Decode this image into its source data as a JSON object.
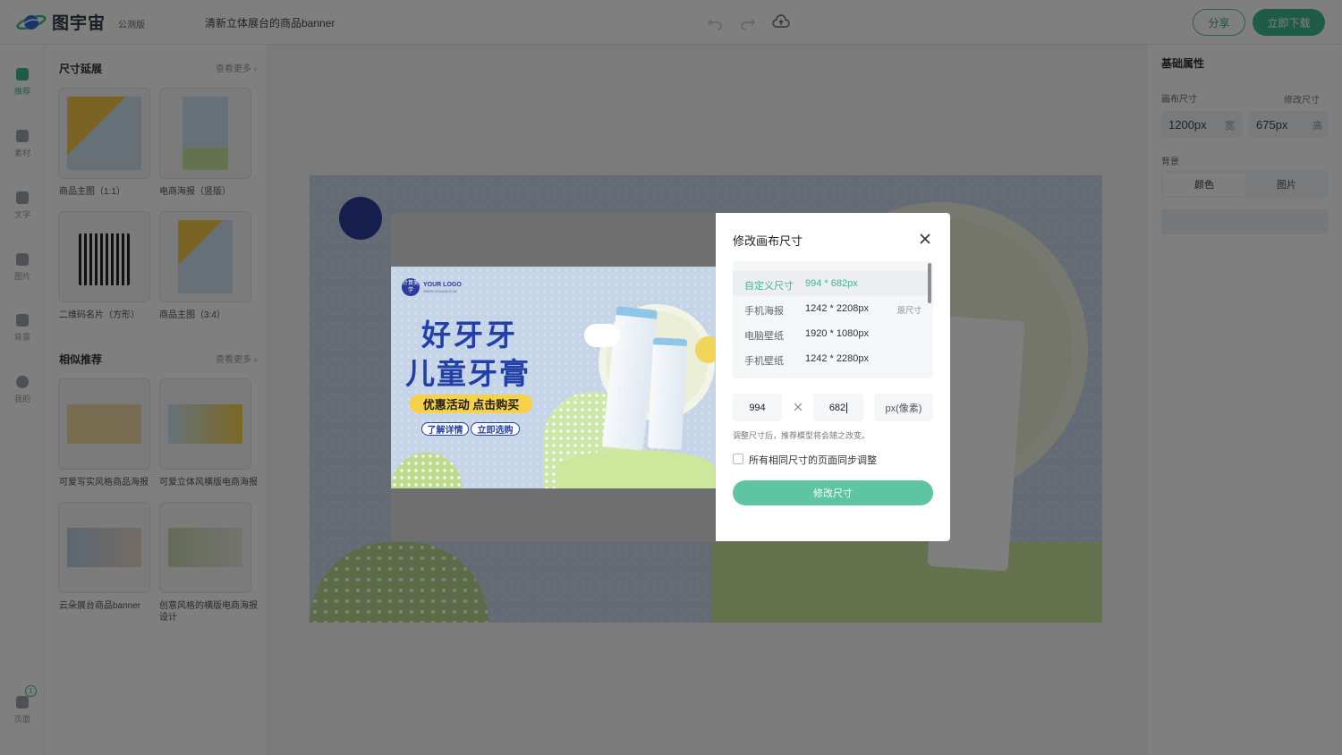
{
  "app": {
    "logo_text": "图宇宙",
    "beta_label": "公测版",
    "doc_title": "清新立体展台的商品banner",
    "share_label": "分享",
    "download_label": "立即下载"
  },
  "rail": [
    {
      "label": "推荐",
      "active": true
    },
    {
      "label": "素材"
    },
    {
      "label": "文字"
    },
    {
      "label": "图片"
    },
    {
      "label": "背景"
    },
    {
      "label": "我的"
    },
    {
      "label": "页面",
      "badge": "1"
    }
  ],
  "panel": {
    "section1": {
      "title": "尺寸延展",
      "more": "查看更多"
    },
    "section1_items": [
      "商品主图（1:1）",
      "电商海报（竖版）",
      "二维码名片（方形）",
      "商品主图（3:4）"
    ],
    "section2": {
      "title": "相似推荐",
      "more": "查看更多"
    },
    "section2_items": [
      "可爱写实风格商品海报",
      "可爱立体风横版电商海报",
      "云朵展台商品banner",
      "创意风格的横版电商海报设计"
    ]
  },
  "props": {
    "title": "基础属性",
    "canvas_size_label": "画布尺寸",
    "modify_size_label": "修改尺寸",
    "width_value": "1200px",
    "width_unit": "宽",
    "height_value": "675px",
    "height_unit": "高",
    "background_label": "背景",
    "bg_color": "颜色",
    "bg_image": "图片"
  },
  "banner": {
    "logo_badge": "计算美学",
    "logo_text": "YOUR LOGO",
    "logo_sub": "WWW.XIGUAN.COM",
    "title1": "好牙牙",
    "title2": "儿童牙膏",
    "promo": "优惠活动 点击购买",
    "btn1": "了解详情",
    "btn2": "立即选购"
  },
  "dialog": {
    "title": "修改画布尺寸",
    "sizes": [
      {
        "name": "自定义尺寸",
        "dim": "994 * 682px",
        "selected": true
      },
      {
        "name": "手机海报",
        "dim": "1242 * 2208px",
        "tag": "原尺寸"
      },
      {
        "name": "电脑壁纸",
        "dim": "1920 * 1080px"
      },
      {
        "name": "手机壁纸",
        "dim": "1242 * 2280px"
      }
    ],
    "width_input": "994",
    "height_input": "682",
    "unit": "px(像素)",
    "hint": "调整尺寸后，推荐模型将会随之改变。",
    "sync_label": "所有相同尺寸的页面同步调整",
    "submit_label": "修改尺寸"
  },
  "colors": {
    "accent": "#3db88f",
    "banner_blue": "#2340a8",
    "promo_yellow": "#f5d24a"
  }
}
